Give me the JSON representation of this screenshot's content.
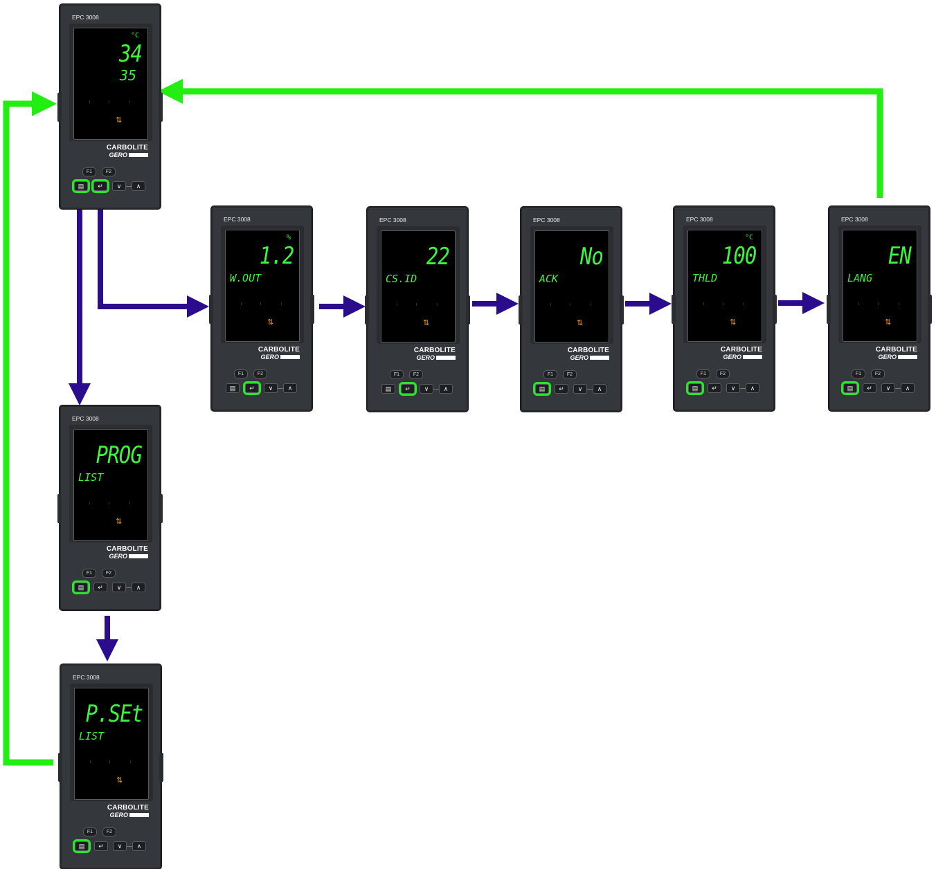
{
  "model": "EPC 3008",
  "brand": {
    "line1": "CARBOLITE",
    "line2": "GERO"
  },
  "keys": {
    "f1": "F1",
    "f2": "F2",
    "page": "▤",
    "scroll": "↵",
    "down": "∨",
    "up": "∧"
  },
  "colors": {
    "lcd": "#3cf53c",
    "flow_arrow": "#2a0c8c",
    "return_arrow": "#22ee11",
    "highlight": "#2ae62a",
    "body": "#34373c"
  },
  "controllers": [
    {
      "id": "home",
      "unit": "°C",
      "value": "34",
      "label": "",
      "sub": "35",
      "highlight": [
        "page",
        "scroll"
      ]
    },
    {
      "id": "w-out",
      "unit": "%",
      "value": "1.2",
      "label": "W.OUT",
      "sub": "",
      "highlight": [
        "scroll"
      ]
    },
    {
      "id": "cs-id",
      "unit": "",
      "value": "22",
      "label": "CS.ID",
      "sub": "",
      "highlight": [
        "scroll"
      ]
    },
    {
      "id": "ack",
      "unit": "",
      "value": "No",
      "label": "ACK",
      "sub": "",
      "highlight": [
        "page"
      ]
    },
    {
      "id": "thld",
      "unit": "°C",
      "value": "100",
      "label": "THLD",
      "sub": "",
      "highlight": [
        "page"
      ]
    },
    {
      "id": "lang",
      "unit": "",
      "value": "EN",
      "label": "LANG",
      "sub": "",
      "highlight": [
        "page"
      ]
    },
    {
      "id": "prog",
      "unit": "",
      "value": "PROG",
      "label": "LIST",
      "sub": "",
      "highlight": [
        "page"
      ]
    },
    {
      "id": "pset",
      "unit": "",
      "value": "P.SEt",
      "label": "LIST",
      "sub": "",
      "highlight": [
        "page"
      ]
    }
  ]
}
